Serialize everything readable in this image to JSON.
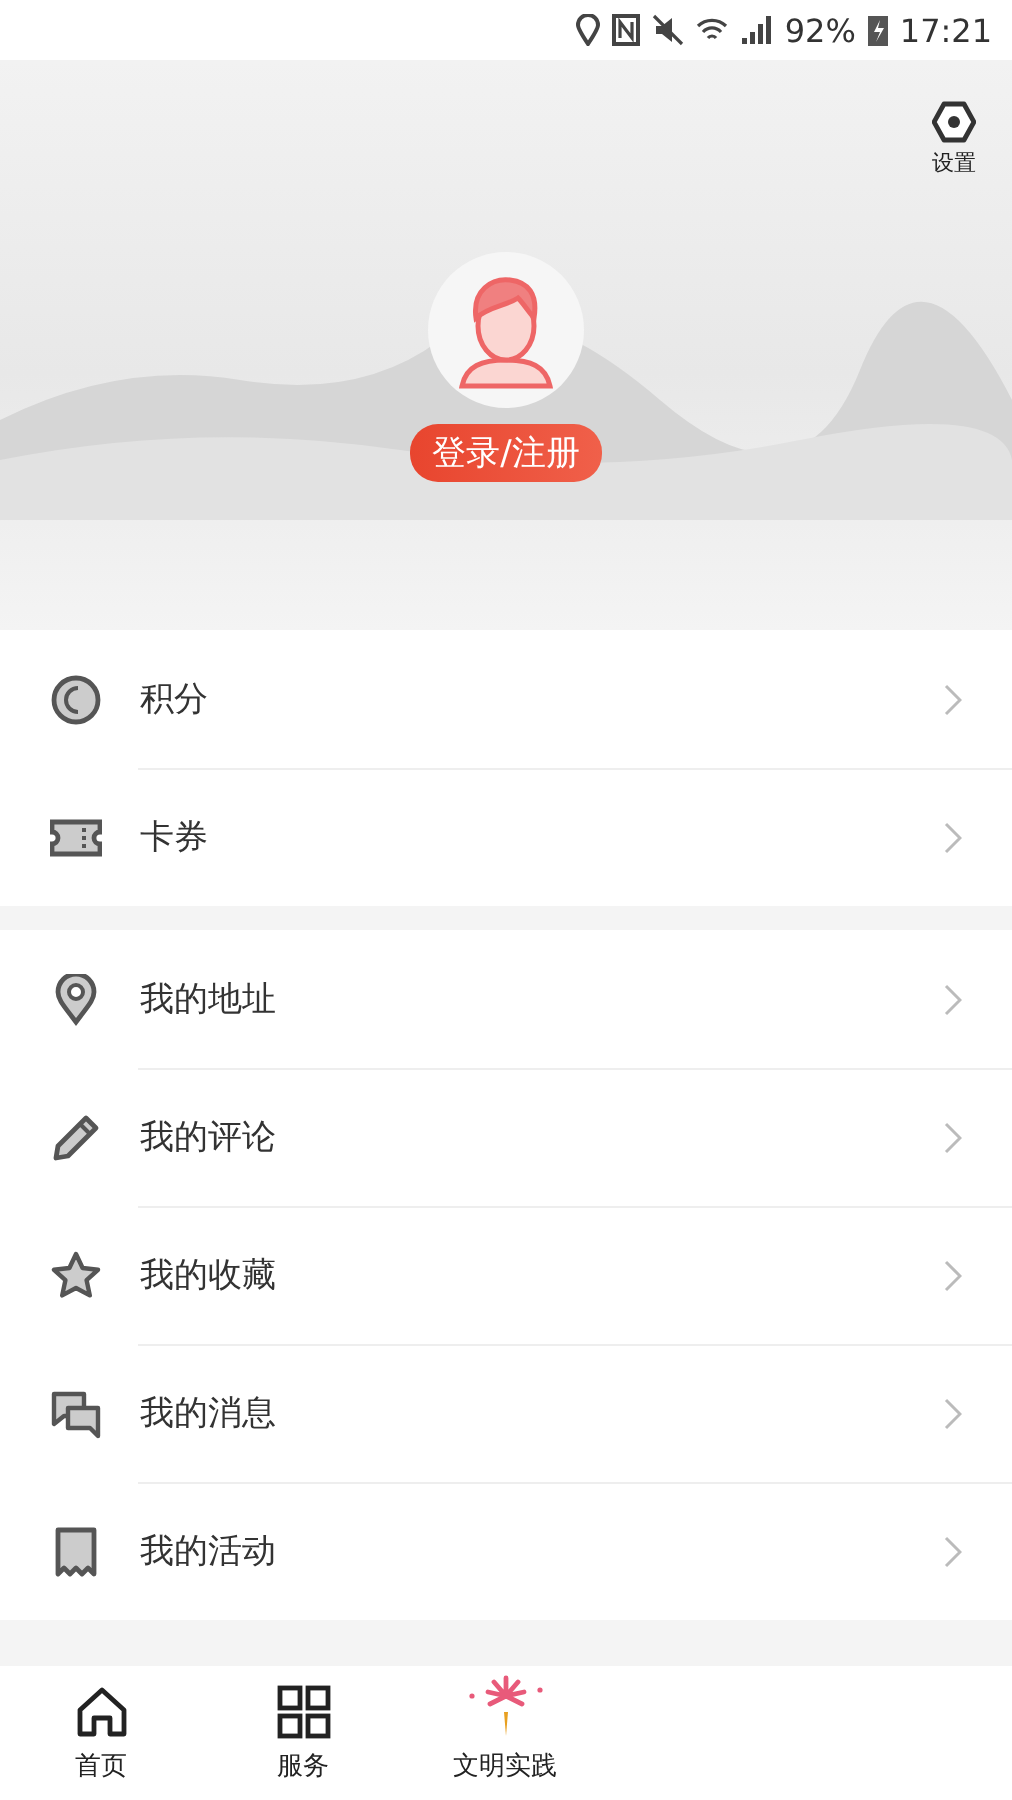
{
  "status_bar": {
    "battery": "92%",
    "time": "17:21"
  },
  "header": {
    "settings_label": "设置",
    "login_button": "登录/注册"
  },
  "menu_groups": [
    {
      "items": [
        {
          "kind": "points",
          "label": "积分"
        },
        {
          "kind": "coupon",
          "label": "卡券"
        }
      ]
    },
    {
      "items": [
        {
          "kind": "location",
          "label": "我的地址"
        },
        {
          "kind": "pencil",
          "label": "我的评论"
        },
        {
          "kind": "star",
          "label": "我的收藏"
        },
        {
          "kind": "chat",
          "label": "我的消息"
        },
        {
          "kind": "bookmark",
          "label": "我的活动"
        }
      ]
    }
  ],
  "tab_bar": [
    {
      "kind": "home",
      "label": "首页"
    },
    {
      "kind": "grid",
      "label": "服务"
    },
    {
      "kind": "firework",
      "label": "文明实践"
    }
  ]
}
